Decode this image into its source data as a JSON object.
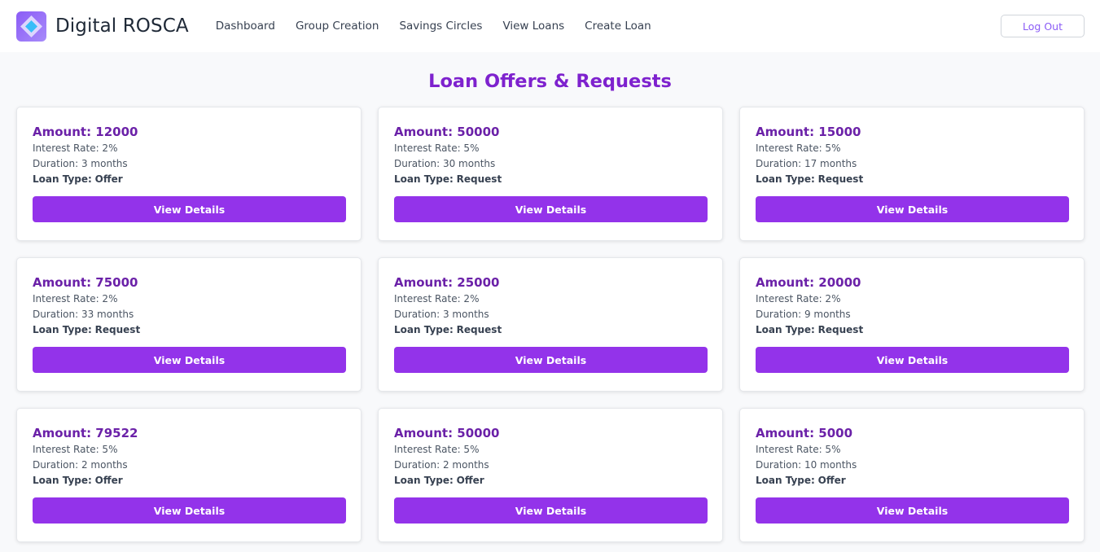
{
  "brand": {
    "name": "Digital ROSCA",
    "logo_icon": "rosca-logo-icon"
  },
  "nav": {
    "links": [
      "Dashboard",
      "Group Creation",
      "Savings Circles",
      "View Loans",
      "Create Loan"
    ],
    "logout_label": "Log Out"
  },
  "page": {
    "title": "Loan Offers & Requests"
  },
  "labels": {
    "amount_prefix": "Amount: ",
    "interest_prefix": "Interest Rate: ",
    "duration_prefix": "Duration: ",
    "type_label": "Loan Type:",
    "view_details": "View Details"
  },
  "loans": [
    {
      "amount": "12000",
      "interest_rate": "2%",
      "duration": "3 months",
      "type": "Offer"
    },
    {
      "amount": "50000",
      "interest_rate": "5%",
      "duration": "30 months",
      "type": "Request"
    },
    {
      "amount": "15000",
      "interest_rate": "5%",
      "duration": "17 months",
      "type": "Request"
    },
    {
      "amount": "75000",
      "interest_rate": "2%",
      "duration": "33 months",
      "type": "Request"
    },
    {
      "amount": "25000",
      "interest_rate": "2%",
      "duration": "3 months",
      "type": "Request"
    },
    {
      "amount": "20000",
      "interest_rate": "2%",
      "duration": "9 months",
      "type": "Request"
    },
    {
      "amount": "79522",
      "interest_rate": "5%",
      "duration": "2 months",
      "type": "Offer"
    },
    {
      "amount": "50000",
      "interest_rate": "5%",
      "duration": "2 months",
      "type": "Offer"
    },
    {
      "amount": "5000",
      "interest_rate": "5%",
      "duration": "10 months",
      "type": "Offer"
    }
  ],
  "colors": {
    "accent": "#9333ea",
    "title": "#7e22ce",
    "amount": "#6b21a8",
    "logout_text": "#8b5cf6"
  }
}
